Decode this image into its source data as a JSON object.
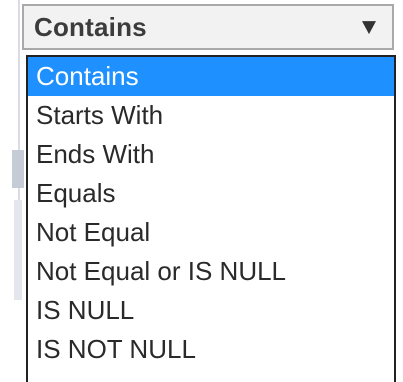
{
  "select": {
    "value": "Contains",
    "arrow_icon": "dropdown-arrow-icon"
  },
  "dropdown": {
    "selected_index": 0,
    "highlight_color": "#1e90ff",
    "options": [
      {
        "label": "Contains"
      },
      {
        "label": "Starts With"
      },
      {
        "label": "Ends With"
      },
      {
        "label": "Equals"
      },
      {
        "label": "Not Equal"
      },
      {
        "label": "Not Equal or IS NULL"
      },
      {
        "label": "IS NULL"
      },
      {
        "label": "IS NOT NULL"
      }
    ]
  }
}
